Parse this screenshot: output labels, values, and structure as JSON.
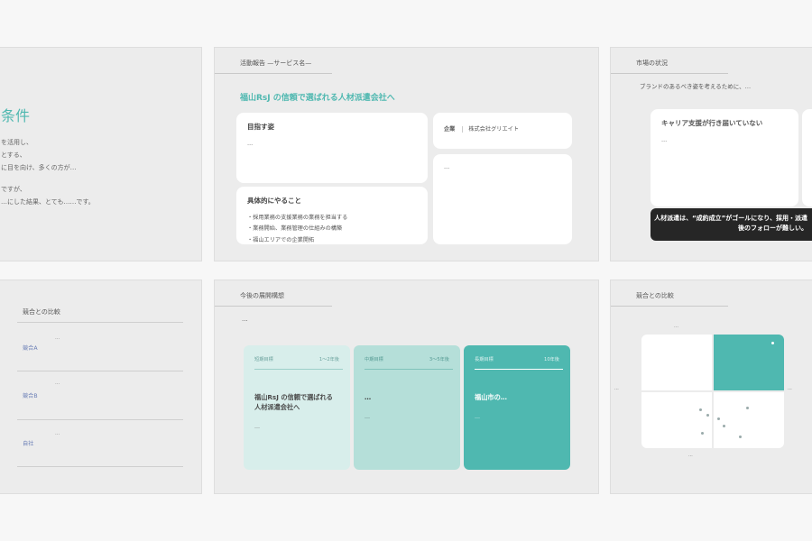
{
  "slides": [
    {
      "title_partial": "条件",
      "lines": [
        "を活用し、",
        "とする、",
        "に目を向け、多くの方が…",
        "ですが、",
        "…にした結果、とても……です。"
      ],
      "page": ""
    },
    {
      "section": "活動報告 —サービス名—",
      "heading": "福山RsJ の信頼で選ばれる人材派遣会社へ",
      "card1_title": "目指す姿",
      "card1_text": "…",
      "card2_label": "企業",
      "card2_value": "株式会社グリエイト",
      "card3_title": "具体的にやること",
      "card3_items": [
        "・採用業務の支援業務の業務を担当する",
        "・業務開始、業務管理の仕組みの構築",
        "・福山エリアでの企業開拓"
      ],
      "card4_text": "…",
      "page": ""
    },
    {
      "section": "市場の状況",
      "intro": "ブランドのあるべき姿を考えるために、…",
      "card_title": "キャリア支援が行き届いていない",
      "card_text": "…",
      "banner": "人材派遣は、“成約成立”がゴールになり、採用・派遣後のフォローが難しい。",
      "page": ""
    },
    {
      "section": "競合との比較",
      "rows": [
        {
          "label": "競合A",
          "text": "…"
        },
        {
          "label": "競合B",
          "text": "…"
        },
        {
          "label": "自社",
          "text": "…"
        }
      ],
      "page": ""
    },
    {
      "section": "今後の展開構想",
      "intro": "…",
      "stages": [
        {
          "left": "短期目標",
          "right": "1〜2年後",
          "title": "福山RsJ の信頼で選ばれる人材派遣会社へ",
          "text": "…"
        },
        {
          "left": "中期目標",
          "right": "3〜5年後",
          "title": "…",
          "text": "…"
        },
        {
          "left": "長期目標",
          "right": "10年後",
          "title": "福山市の…",
          "text": "…"
        }
      ],
      "page": ""
    },
    {
      "section": "競合との比較",
      "axis_top": "…",
      "axis_left": "…",
      "axis_right": "…",
      "axis_bottom": "…",
      "page": ""
    }
  ],
  "colors": {
    "accent": "#4fb8b0",
    "accent_light": "#c9e7e3",
    "accent_mid": "#a9d9d3",
    "dark": "#262626"
  }
}
